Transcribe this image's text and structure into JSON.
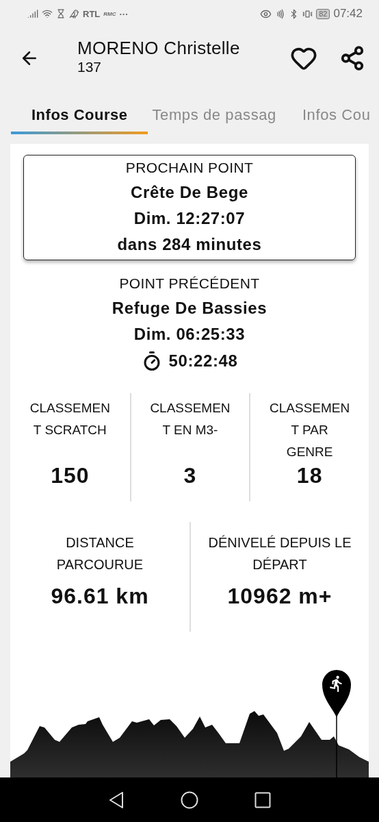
{
  "status_bar": {
    "labels": [
      "RTL",
      "RMC",
      "···"
    ],
    "battery": "82",
    "time": "07:42"
  },
  "header": {
    "title": "MORENO Christelle",
    "subtitle": "137"
  },
  "tabs": [
    {
      "label": "Infos Course",
      "selected": true
    },
    {
      "label": "Temps de passag",
      "selected": false
    },
    {
      "label": "Infos Cou",
      "selected": false
    }
  ],
  "next_point": {
    "heading": "PROCHAIN POINT",
    "name": "Crête De Bege",
    "time": "Dim. 12:27:07",
    "eta": "dans 284 minutes"
  },
  "previous_point": {
    "heading": "POINT PRÉCÉDENT",
    "name": "Refuge De Bassies",
    "time": "Dim. 06:25:33",
    "elapsed": "50:22:48"
  },
  "rankings": [
    {
      "label": "CLASSEMENT SCRATCH",
      "value": "150"
    },
    {
      "label": "CLASSEMENT EN M3-",
      "value": "3"
    },
    {
      "label": "CLASSEMENT PAR GENRE",
      "value": "18"
    }
  ],
  "totals": [
    {
      "label": "DISTANCE PARCOURUE",
      "value": "96.61 km"
    },
    {
      "label": "DÉNIVELÉ DEPUIS LE DÉPART",
      "value": "10962 m+"
    }
  ]
}
